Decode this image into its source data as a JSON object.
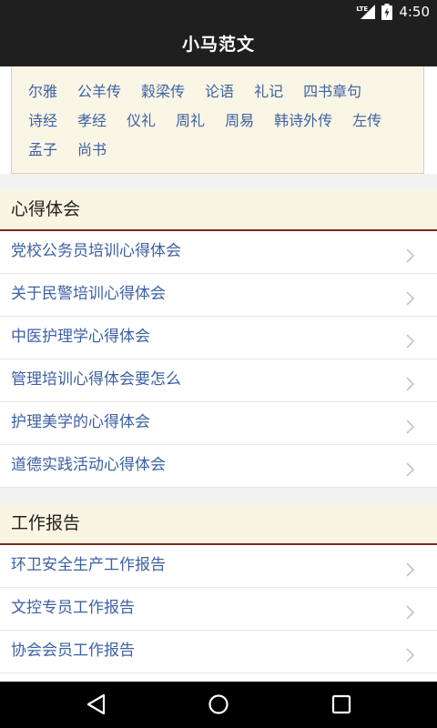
{
  "status_bar": {
    "network_label": "LTE",
    "time": "4:50"
  },
  "app": {
    "title": "小马范文"
  },
  "tags": [
    [
      "尔雅",
      "公羊传",
      "穀梁传",
      "论语",
      "礼记",
      "四书章句"
    ],
    [
      "诗经",
      "孝经",
      "仪礼",
      "周礼",
      "周易",
      "韩诗外传",
      "左传"
    ],
    [
      "孟子",
      "尚书"
    ]
  ],
  "sections": [
    {
      "title": "心得体会",
      "items": [
        "党校公务员培训心得体会",
        "关于民警培训心得体会",
        "中医护理学心得体会",
        "管理培训心得体会要怎么",
        "护理美学的心得体会",
        "道德实践活动心得体会"
      ]
    },
    {
      "title": "工作报告",
      "items": [
        "环卫安全生产工作报告",
        "文控专员工作报告",
        "协会会员工作报告"
      ]
    }
  ],
  "colors": {
    "bar_bg": "#1f1f1f",
    "link_blue": "#3c61a3",
    "section_bg": "#faf4e2",
    "section_rule": "#7a2a1e",
    "tagbox_bg": "#faf6e6"
  },
  "icons": {
    "status": [
      "signal-icon",
      "battery-icon"
    ],
    "nav": [
      "back-icon",
      "home-icon",
      "recents-icon"
    ],
    "list": "chevron-right-icon"
  }
}
